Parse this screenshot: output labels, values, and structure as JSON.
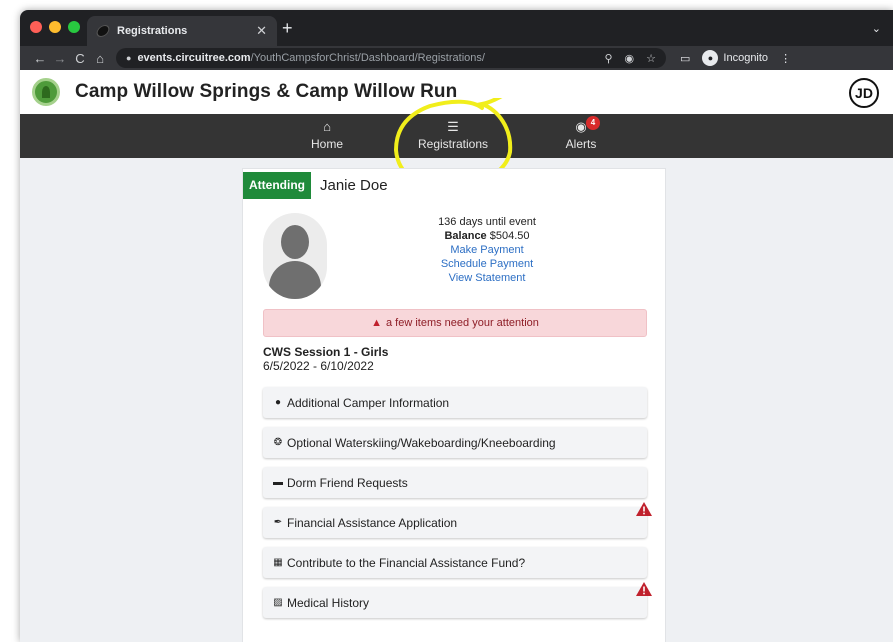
{
  "browser": {
    "tab_title": "Registrations",
    "tab_close": "✕",
    "new_tab": "+",
    "tab_menu": "⌄",
    "back": "←",
    "forward": "→",
    "reload": "C",
    "home": "⌂",
    "url_host": "events.circuitree.com",
    "url_path": "/YouthCampsforChrist/Dashboard/Registrations/",
    "incognito_label": "Incognito",
    "menu": "⋮",
    "traffic_colors": [
      "#ff5f57",
      "#febc2e",
      "#28c840"
    ]
  },
  "site": {
    "title": "Camp Willow Springs & Camp Willow Run",
    "user_initials": "JD"
  },
  "nav": {
    "items": [
      {
        "label": "Home",
        "icon": "home-icon"
      },
      {
        "label": "Registrations",
        "icon": "list-icon"
      },
      {
        "label": "Alerts",
        "icon": "bell-icon",
        "badge": "4"
      }
    ]
  },
  "registration": {
    "status": "Attending",
    "camper_name": "Janie Doe",
    "days_until": "136 days until event",
    "balance_label": "Balance",
    "balance_value": "$504.50",
    "links": [
      "Make Payment",
      "Schedule Payment",
      "View Statement"
    ],
    "attention_message": "a few items need your attention",
    "session_name": "CWS Session 1 - Girls",
    "session_dates": "6/5/2022 - 6/10/2022",
    "forms": [
      {
        "label": "Additional Camper Information",
        "icon": "user-icon",
        "alert": false
      },
      {
        "label": "Optional Waterskiing/Wakeboarding/Kneeboarding",
        "icon": "life-ring-icon",
        "alert": false
      },
      {
        "label": "Dorm Friend Requests",
        "icon": "bed-icon",
        "alert": false
      },
      {
        "label": "Financial Assistance Application",
        "icon": "paperclip-icon",
        "alert": true
      },
      {
        "label": "Contribute to the Financial Assistance Fund?",
        "icon": "gift-icon",
        "alert": false
      },
      {
        "label": "Medical History",
        "icon": "medkit-icon",
        "alert": true
      }
    ]
  },
  "colors": {
    "status_green": "#1f8a3a",
    "nav_bg": "#343434",
    "alert_red": "#c0212d",
    "link_blue": "#2d6fc4"
  }
}
